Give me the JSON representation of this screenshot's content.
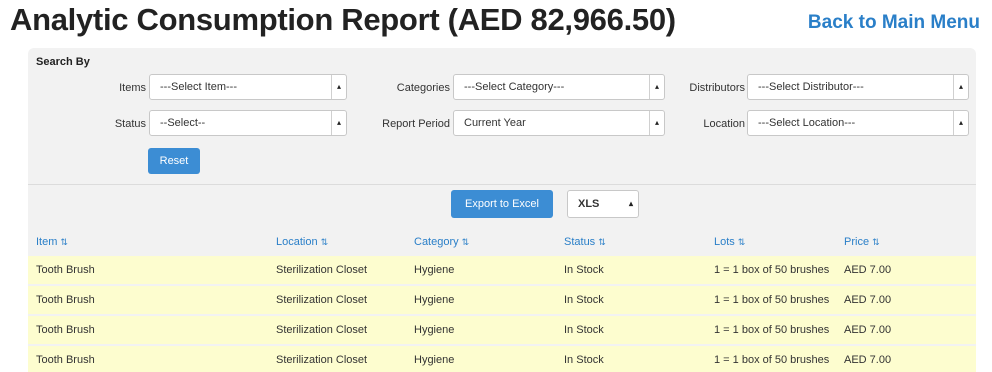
{
  "title": "Analytic Consumption Report (AED 82,966.50)",
  "back_link": "Back to Main Menu",
  "search": {
    "heading": "Search By",
    "filters": {
      "items": {
        "label": "Items",
        "value": "---Select Item---"
      },
      "categories": {
        "label": "Categories",
        "value": "---Select Category---"
      },
      "distributors": {
        "label": "Distributors",
        "value": "---Select Distributor---"
      },
      "status": {
        "label": "Status",
        "value": "--Select--"
      },
      "report_period": {
        "label": "Report Period",
        "value": "Current Year"
      },
      "location": {
        "label": "Location",
        "value": "---Select Location---"
      }
    },
    "reset_label": "Reset"
  },
  "export": {
    "button_label": "Export to Excel",
    "format": "XLS"
  },
  "table": {
    "columns": [
      "Item",
      "Location",
      "Category",
      "Status",
      "Lots",
      "Price"
    ],
    "rows": [
      [
        "Tooth Brush",
        "Sterilization Closet",
        "Hygiene",
        "In Stock",
        "1 = 1 box of 50 brushes",
        "AED 7.00"
      ],
      [
        "Tooth Brush",
        "Sterilization Closet",
        "Hygiene",
        "In Stock",
        "1 = 1 box of 50 brushes",
        "AED 7.00"
      ],
      [
        "Tooth Brush",
        "Sterilization Closet",
        "Hygiene",
        "In Stock",
        "1 = 1 box of 50 brushes",
        "AED 7.00"
      ],
      [
        "Tooth Brush",
        "Sterilization Closet",
        "Hygiene",
        "In Stock",
        "1 = 1 box of 50 brushes",
        "AED 7.00"
      ]
    ]
  },
  "colors": {
    "accent": "#3c8dd4",
    "link": "#2a7fc8",
    "row_highlight": "#fdfdcf",
    "panel": "#f2f2f2"
  }
}
